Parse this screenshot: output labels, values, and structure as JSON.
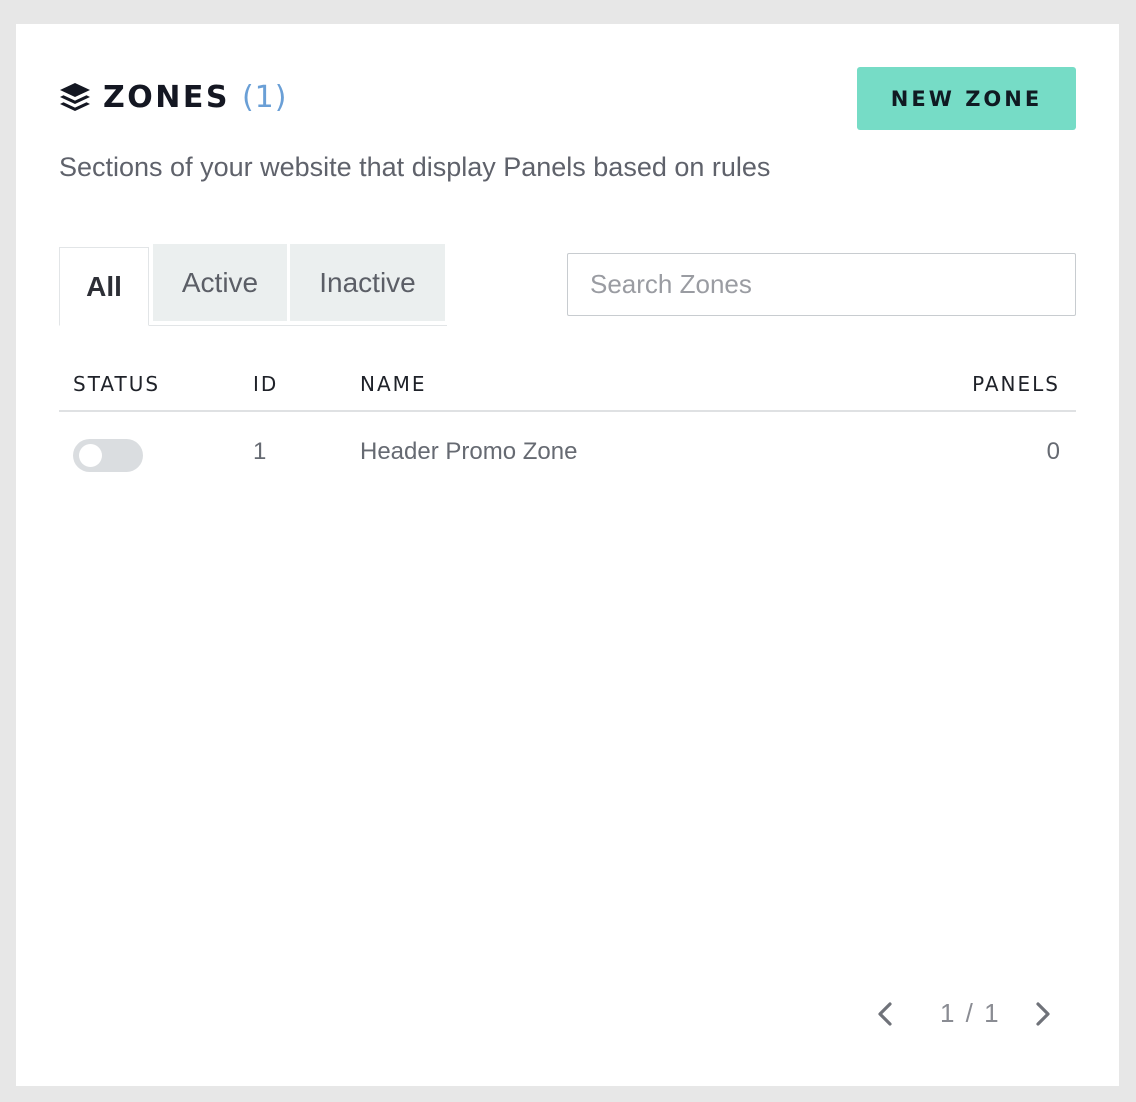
{
  "header": {
    "title": "ZONES",
    "count": "(1)",
    "subtitle": "Sections of your website that display Panels based on rules",
    "new_button_label": "NEW ZONE",
    "icon": "layers-icon"
  },
  "tabs": [
    {
      "label": "All",
      "active": true
    },
    {
      "label": "Active",
      "active": false
    },
    {
      "label": "Inactive",
      "active": false
    }
  ],
  "search": {
    "placeholder": "Search Zones",
    "value": ""
  },
  "table": {
    "columns": [
      "STATUS",
      "ID",
      "NAME",
      "PANELS"
    ],
    "rows": [
      {
        "status": "off",
        "id": "1",
        "name": "Header Promo Zone",
        "panels": "0"
      }
    ]
  },
  "pagination": {
    "text": "1 / 1",
    "prev_icon": "chevron-left-icon",
    "next_icon": "chevron-right-icon"
  },
  "colors": {
    "accent": "#76dcc6",
    "count": "#6a9fd6",
    "background": "#e7e7e7"
  }
}
